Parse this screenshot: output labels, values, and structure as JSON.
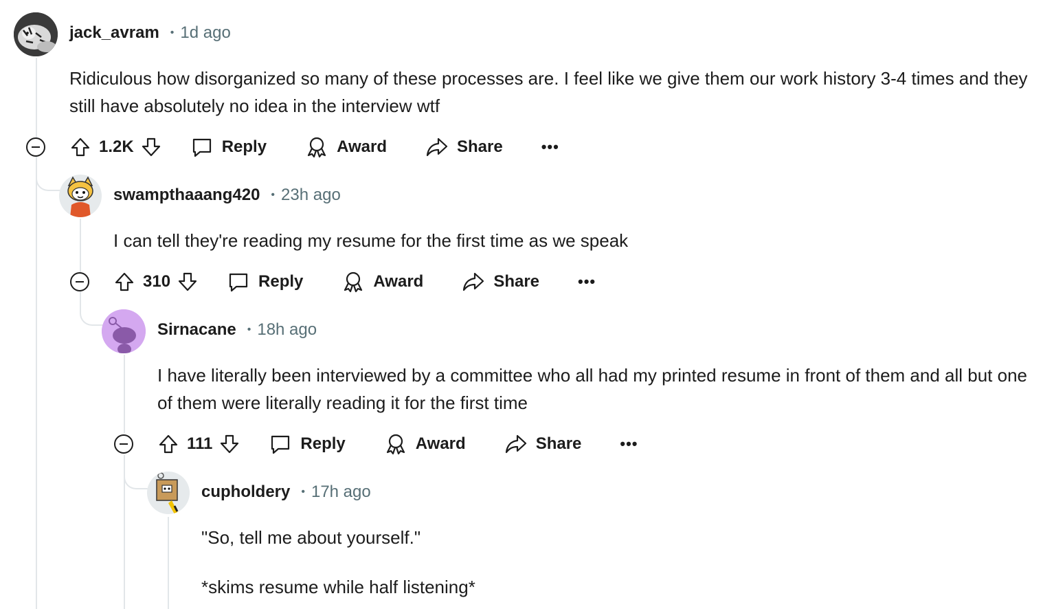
{
  "comments": [
    {
      "username": "jack_avram",
      "time": "1d ago",
      "body": [
        "Ridiculous how disorganized so many of these processes are. I feel like we give them our work history 3-4 times and they still have absolutely no idea in the interview wtf"
      ],
      "score": "1.2K",
      "avatar": "white-tiger-photo"
    },
    {
      "username": "swampthaaang420",
      "time": "23h ago",
      "body": [
        "I can tell they're reading my resume for the first time as we speak"
      ],
      "score": "310",
      "avatar": "snoo-dog-costume"
    },
    {
      "username": "Sirnacane",
      "time": "18h ago",
      "body": [
        "I have literally been interviewed by a committee who all had my printed resume in front of them and all but one of them were literally reading it for the first time"
      ],
      "score": "111",
      "avatar": "default-snoo-purple"
    },
    {
      "username": "cupholdery",
      "time": "17h ago",
      "body": [
        "\"So, tell me about yourself.\"",
        "*skims resume while half listening*"
      ],
      "avatar": "snoo-box-costume"
    }
  ],
  "actions": {
    "reply": "Reply",
    "award": "Award",
    "share": "Share",
    "more": "•••"
  },
  "separator": "•",
  "colors": {
    "text": "#1c1c1c",
    "meta": "#576f76",
    "thread_line": "#e2e6e9",
    "avatar_purple": "#d4a8f0"
  },
  "icons": [
    "upvote-icon",
    "downvote-icon",
    "reply-icon",
    "award-icon",
    "share-icon",
    "collapse-icon",
    "more-icon"
  ]
}
